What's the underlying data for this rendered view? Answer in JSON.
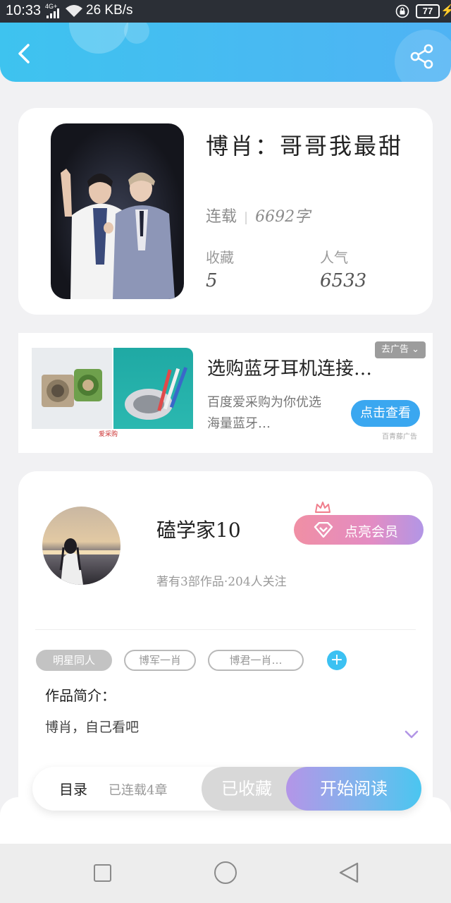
{
  "status_bar": {
    "time": "10:33",
    "network": "4G+",
    "speed": "26 KB/s",
    "battery": "77"
  },
  "header": {
    "back_icon": "chevron-left-icon",
    "share_icon": "share-icon",
    "gradient": [
      "#3ec3ef",
      "#4fb3f4"
    ]
  },
  "book": {
    "title": "博肖：哥哥我最甜",
    "status": "连载",
    "word_count": "6692字",
    "favorites_label": "收藏",
    "favorites_value": "5",
    "popularity_label": "人气",
    "popularity_value": "6533"
  },
  "ad": {
    "title": "选购蓝牙耳机连接…",
    "description": "百度爱采购为你优选海量蓝牙…",
    "close_label": "去广告",
    "cta_label": "点击查看",
    "note": "百青藤广告",
    "brand": "爱采购"
  },
  "author": {
    "name": "磕学家10",
    "vip_label": "点亮会员",
    "meta": "著有3部作品·204人关注",
    "tags": [
      "明星同人",
      "博军一肖",
      "博君一肖…"
    ],
    "intro_label": "作品简介：",
    "intro_text": "博肖，自己看吧",
    "accent": "#b296e6"
  },
  "action_bar": {
    "toc_label": "目录",
    "chapters_label": "已连载4章",
    "favorite_label": "已收藏",
    "read_label": "开始阅读"
  },
  "nav_bar": {
    "recents_icon": "square-icon",
    "home_icon": "circle-icon",
    "back_icon": "triangle-back-icon"
  }
}
